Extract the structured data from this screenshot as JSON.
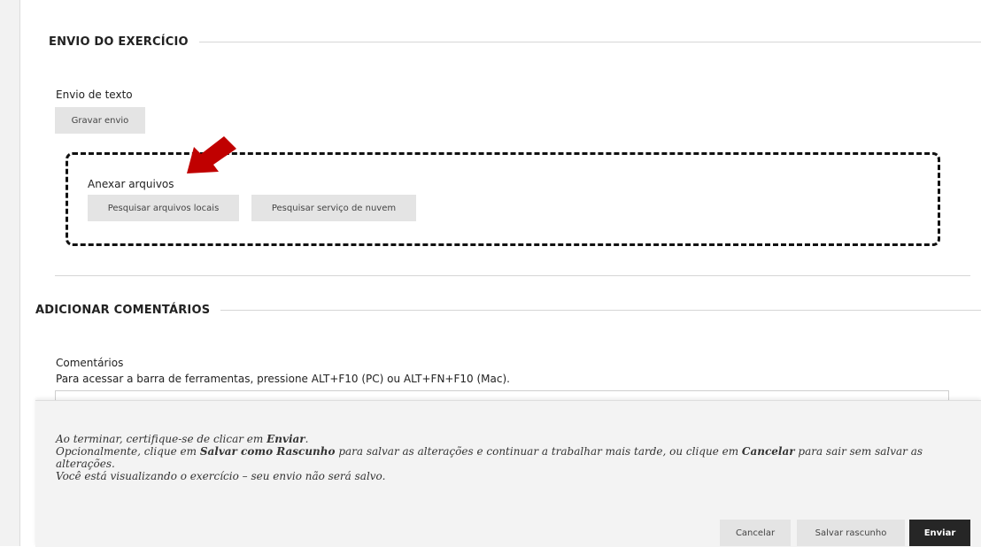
{
  "sections": {
    "submission": {
      "title": "ENVIO DO EXERCÍCIO"
    },
    "comments": {
      "title": "ADICIONAR COMENTÁRIOS"
    }
  },
  "text_submission": {
    "label": "Envio de texto",
    "button": "Gravar envio"
  },
  "attach": {
    "label": "Anexar arquivos",
    "browse_local": "Pesquisar arquivos locais",
    "browse_cloud": "Pesquisar serviço de nuvem"
  },
  "comments": {
    "label": "Comentários",
    "hint": "Para acessar a barra de ferramentas, pressione ALT+F10 (PC) ou ALT+FN+F10 (Mac)."
  },
  "footer": {
    "line1_prefix": "Ao terminar, certifique-se de clicar em ",
    "line1_bold": "Enviar",
    "line1_suffix": ".",
    "line2_prefix": "Opcionalmente, clique em ",
    "line2_bold1": "Salvar como Rascunho",
    "line2_mid": " para salvar as alterações e continuar a trabalhar mais tarde, ou clique em ",
    "line2_bold2": "Cancelar",
    "line2_suffix": " para sair sem salvar as alterações.",
    "line3": "Você está visualizando o exercício – seu envio não será salvo.",
    "cancel": "Cancelar",
    "save_draft": "Salvar rascunho",
    "submit": "Enviar"
  },
  "colors": {
    "annotation_arrow": "#c00000",
    "primary_button": "#262626"
  },
  "icons": {
    "annotation": "red-arrow-icon"
  }
}
